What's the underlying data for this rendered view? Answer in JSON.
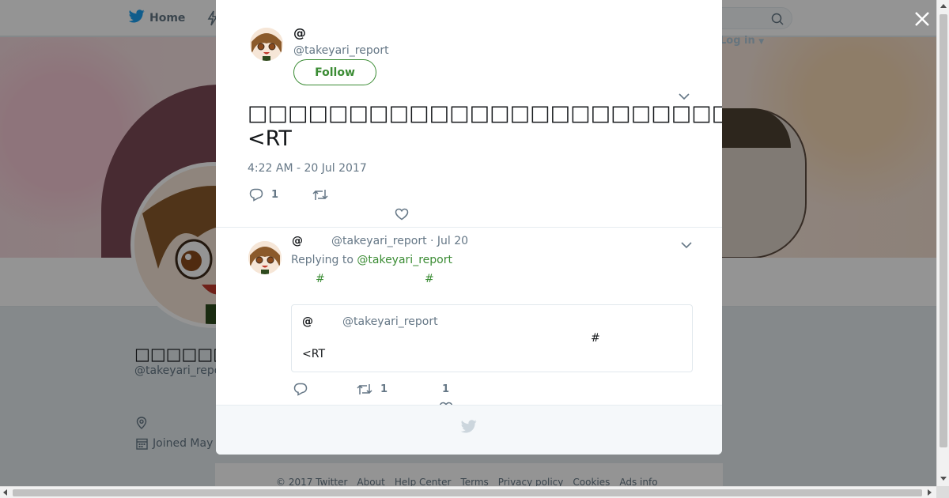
{
  "colors": {
    "accent": "#3b8c34",
    "text": "#14171a",
    "muted": "#657786",
    "twitter_blue": "#1da1f2"
  },
  "topbar": {
    "home_label": "Home",
    "login_label": "Log in",
    "icons": [
      "twitter-bird-icon",
      "moments-icon",
      "search-icon",
      "caret-down-icon"
    ]
  },
  "profile": {
    "name": "□□□□□□□□@",
    "handle": "@takeyari_repo",
    "joined": "Joined May"
  },
  "footer": {
    "links": [
      "© 2017 Twitter",
      "About",
      "Help Center",
      "Terms",
      "Privacy policy",
      "Cookies",
      "Ads info"
    ]
  },
  "tweet": {
    "author_name": "@",
    "author_handle": "@takeyari_report",
    "follow_label": "Follow",
    "text_main": "□□□□□□□□□□□□□□□□□□□□□□□□□□□□□□□□□□□□□□□□□□□□□□□□□□",
    "text_hashtag": "#□□□□□□",
    "text_tail": "□□□",
    "text_line2": "<RT",
    "timestamp": "4:22 AM - 20 Jul 2017",
    "reply_count": "1"
  },
  "reply": {
    "author_name": "@",
    "author_handle": "@takeyari_report",
    "date": "Jul 20",
    "replying_prefix": "Replying to",
    "replying_handle": "@takeyari_report",
    "hashtag_1": "#",
    "hashtag_2": "#",
    "quoted": {
      "author_name": "@",
      "author_handle": "@takeyari_report",
      "hash": "#",
      "text": "<RT"
    },
    "retweet_count": "1",
    "like_count": "1"
  }
}
